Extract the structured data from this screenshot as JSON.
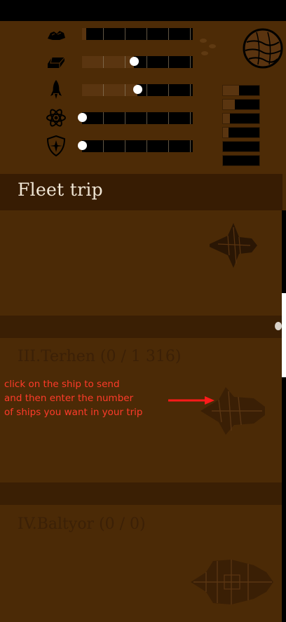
{
  "resources": [
    {
      "icon": "metal-ore-icon",
      "fill": 0.04,
      "knob": null
    },
    {
      "icon": "ingot-icon",
      "fill": 0.47,
      "knob": 0.47
    },
    {
      "icon": "rocket-icon",
      "fill": 0.5,
      "knob": 0.5
    },
    {
      "icon": "atom-icon",
      "fill": 0.0,
      "knob": 0.0
    },
    {
      "icon": "shield-star-icon",
      "fill": 0.0,
      "knob": 0.0
    }
  ],
  "side_bars": [
    0.45,
    0.32,
    0.2,
    0.15,
    0.0,
    0.0
  ],
  "fleet": {
    "title": "Fleet trip"
  },
  "planets": [
    {
      "label": "III.Terhen  (0 / 1 316)"
    },
    {
      "label": "IV.Baltyor  (0 / 0)"
    }
  ],
  "hint": {
    "line1": "click on the ship to send",
    "line2": "and then enter the number",
    "line3": "of ships you want in your trip"
  },
  "colors": {
    "panel": "#4b2a06",
    "header": "#371c03",
    "hint": "#ff3b2a"
  }
}
